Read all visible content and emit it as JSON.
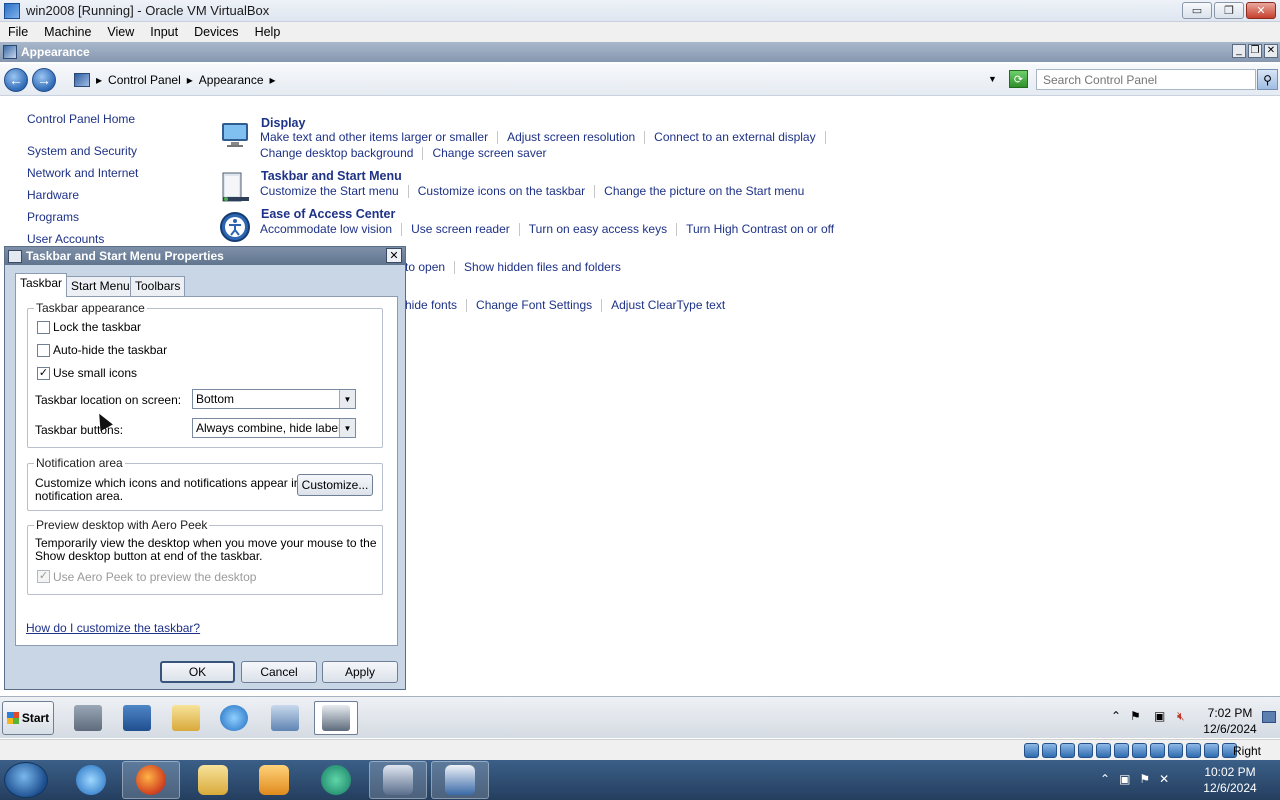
{
  "host_window": {
    "title": "win2008 [Running] - Oracle VM VirtualBox",
    "menu": [
      "File",
      "Machine",
      "View",
      "Input",
      "Devices",
      "Help"
    ],
    "buttons": {
      "minimize": "▭",
      "restore": "❐",
      "close": "✕"
    }
  },
  "control_panel": {
    "window_title": "Appearance",
    "title_buttons": {
      "minimize": "_",
      "restore": "❐",
      "close": "✕"
    },
    "breadcrumb": {
      "root": "Control Panel",
      "current": "Appearance",
      "separator": "▸"
    },
    "search_placeholder": "Search Control Panel",
    "left_nav": [
      "Control Panel Home",
      "System and Security",
      "Network and Internet",
      "Hardware",
      "Programs",
      "User Accounts"
    ],
    "categories": [
      {
        "title": "Display",
        "links": [
          "Make text and other items larger or smaller",
          "Adjust screen resolution",
          "Connect to an external display"
        ],
        "links2": [
          "Change desktop background",
          "Change screen saver"
        ]
      },
      {
        "title": "Taskbar and Start Menu",
        "links": [
          "Customize the Start menu",
          "Customize icons on the taskbar",
          "Change the picture on the Start menu"
        ]
      },
      {
        "title": "Ease of Access Center",
        "links": [
          "Accommodate low vision",
          "Use screen reader",
          "Turn on easy access keys",
          "Turn High Contrast on or off"
        ]
      },
      {
        "title": "",
        "links": [
          "to open",
          "Show hidden files and folders"
        ]
      },
      {
        "title": "",
        "links": [
          "hide fonts",
          "Change Font Settings",
          "Adjust ClearType text"
        ]
      }
    ]
  },
  "dialog": {
    "title": "Taskbar and Start Menu Properties",
    "close": "✕",
    "tabs": [
      "Taskbar",
      "Start Menu",
      "Toolbars"
    ],
    "appearance": {
      "group_title": "Taskbar appearance",
      "lock_label": "Lock the taskbar",
      "autohide_label": "Auto-hide the taskbar",
      "small_icons_label": "Use small icons",
      "small_icons_checked": "✓",
      "location_label": "Taskbar location on screen:",
      "location_value": "Bottom",
      "buttons_label": "Taskbar buttons:",
      "buttons_value": "Always combine, hide labels"
    },
    "notification": {
      "group_title": "Notification area",
      "text_line1": "Customize which icons and notifications appear in the",
      "text_line2": "notification area.",
      "customize_button": "Customize..."
    },
    "aero_peek": {
      "group_title": "Preview desktop with Aero Peek",
      "text_line1": "Temporarily view the desktop when you move your mouse to the",
      "text_line2": "Show desktop button at end of the taskbar.",
      "checkbox_label": "Use Aero Peek to preview the desktop",
      "checkbox_mark": "✓"
    },
    "help_link": "How do I customize the taskbar?",
    "buttons": {
      "ok": "OK",
      "cancel": "Cancel",
      "apply": "Apply"
    }
  },
  "guest_taskbar": {
    "start_label": "Start",
    "tray_expand": "⌃",
    "clock_time": "7:02 PM",
    "clock_date": "12/6/2024"
  },
  "vb_status": {
    "host_key": "Right Ctrl"
  },
  "host_taskbar": {
    "clock_time": "10:02 PM",
    "clock_date": "12/6/2024",
    "tray_expand": "⌃"
  }
}
